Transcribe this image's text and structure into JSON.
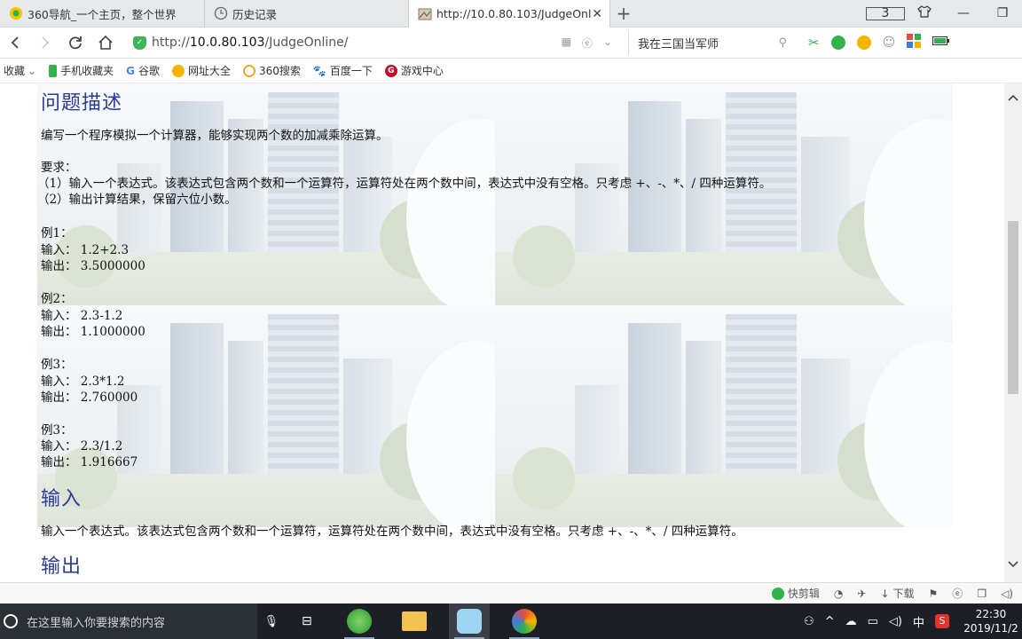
{
  "tabs": [
    {
      "label": "360导航_一个主页，整个世界",
      "icon": "360-nav-icon"
    },
    {
      "label": "历史记录",
      "icon": "history-clock-icon"
    },
    {
      "label": "http://10.0.80.103/JudgeOnlin",
      "icon": "page-thumbnail-icon",
      "active": true,
      "close": "✕"
    }
  ],
  "window": {
    "tab_count": "3"
  },
  "nav": {
    "url_scheme": "http://",
    "url_host": "10.0.80.103",
    "url_path": "/JudgeOnline/",
    "search_text": "我在三国当军师"
  },
  "bookmarks": {
    "folder_label": "收藏",
    "items": [
      {
        "label": "手机收藏夹",
        "color": "#2fb34a"
      },
      {
        "label": "谷歌",
        "color": "#4285f4",
        "glyph": "G"
      },
      {
        "label": "网址大全",
        "color": "#f5b400"
      },
      {
        "label": "360搜索",
        "color": "#f5a623"
      },
      {
        "label": "百度一下",
        "color": "#2f64d6"
      },
      {
        "label": "游戏中心",
        "color": "#c0132b",
        "glyph": "G"
      }
    ]
  },
  "page": {
    "heading_problem": "问题描述",
    "desc": "编写一个程序模拟一个计算器，能够实现两个数的加减乘除运算。",
    "req_title": "要求：",
    "req1": "（1）输入一个表达式。该表达式包含两个数和一个运算符，运算符处在两个数中间，表达式中没有空格。只考虑 +、-、*、/ 四种运算符。",
    "req2": "（2）输出计算结果，保留六位小数。",
    "examples": [
      {
        "title": "例1：",
        "input": "输入：  1.2+2.3",
        "output": "输出：  3.5000000"
      },
      {
        "title": "例2：",
        "input": "输入：  2.3-1.2",
        "output": "输出：  1.1000000"
      },
      {
        "title": "例3：",
        "input": "输入：  2.3*1.2",
        "output": "输出：  2.760000"
      },
      {
        "title": "例3：",
        "input": "输入：  2.3/1.2",
        "output": "输出：  1.916667"
      }
    ],
    "heading_input": "输入",
    "input_desc": "输入一个表达式。该表达式包含两个数和一个运算符，运算符处在两个数中间，表达式中没有空格。只考虑 +、-、*、/ 四种运算符。",
    "heading_output": "输出"
  },
  "statusbar": {
    "quickcut": "快剪辑",
    "download": "下载"
  },
  "taskbar": {
    "search_placeholder": "在这里输入你要搜索的内容",
    "ime": "中",
    "time": "22:30",
    "date": "2019/11/2"
  }
}
